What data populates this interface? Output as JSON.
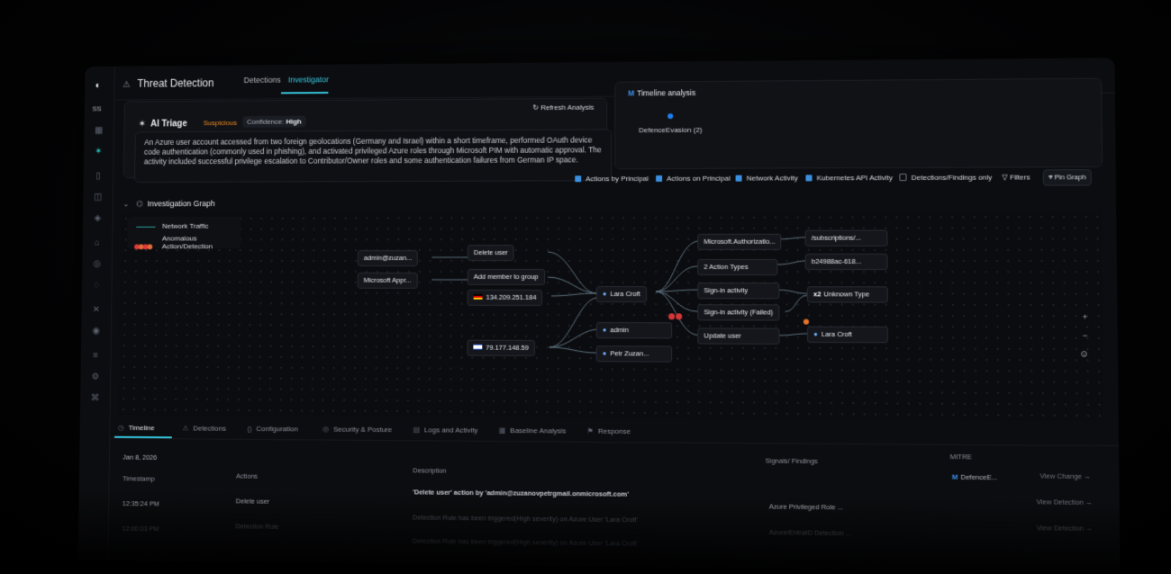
{
  "sidebar": {
    "initials": "SS"
  },
  "topbar": {
    "title": "Threat Detection",
    "tabs": [
      {
        "label": "Detections"
      },
      {
        "label": "Investigator"
      }
    ]
  },
  "ai_triage": {
    "title": "AI Triage",
    "verdict": "Suspicious",
    "confidence_label": "Confidence:",
    "confidence_value": "High",
    "refresh_label": "Refresh Analysis",
    "description": "An Azure user account accessed from two foreign geolocations (Germany and Israel) within a short timeframe, performed OAuth device code authentication (commonly used in phishing), and activated privileged Azure roles through Microsoft PIM with automatic approval. The activity included successful privilege escalation to Contributor/Owner roles and some authentication failures from German IP space."
  },
  "timeline_analysis": {
    "title": "Timeline analysis",
    "item": "DefenceEvasion (2)"
  },
  "filters": {
    "checkboxes": [
      {
        "label": "Actions by Principal",
        "checked": true
      },
      {
        "label": "Actions on Principal",
        "checked": true
      },
      {
        "label": "Network Activity",
        "checked": true
      },
      {
        "label": "Kubernetes API Activity",
        "checked": true
      },
      {
        "label": "Detections/Findings only",
        "checked": false
      }
    ],
    "filters_label": "Filters",
    "pin_label": "Pin Graph"
  },
  "graph": {
    "title": "Investigation Graph",
    "legend": {
      "network": "Network Traffic",
      "anomalous": "Anomalous Action/Detection"
    },
    "nodes": {
      "admin_principal": "admin@zuzan...",
      "ms_app": "Microsoft Appr...",
      "delete_user": "Delete user",
      "add_member": "Add member to group",
      "ip_de": "134.209.251.184",
      "ip_il": "79.177.148.59",
      "lara": "Lara Croft",
      "admin": "admin",
      "petr": "Petr Zuzan...",
      "ms_auth": "Microsoft.Authorizatio...",
      "action_types": "2 Action Types",
      "signin": "Sign-in activity",
      "signin_failed": "Sign-in activity (Failed)",
      "update_user": "Update user",
      "subscriptions": "/subscriptions/...",
      "hash": "b24988ac-618...",
      "unknown": "Unknown Type",
      "unknown_mult": "x2",
      "lara_target": "Lara Croft"
    },
    "zoom": {
      "in": "+",
      "out": "−",
      "fit": "⊙"
    }
  },
  "bottom_tabs": [
    {
      "label": "Timeline"
    },
    {
      "label": "Detections"
    },
    {
      "label": "Configuration"
    },
    {
      "label": "Security & Posture"
    },
    {
      "label": "Logs and Activity"
    },
    {
      "label": "Baseline Analysis"
    },
    {
      "label": "Response"
    }
  ],
  "table": {
    "date": "Jan 8, 2026",
    "headers": {
      "timestamp": "Timestamp",
      "actions": "Actions",
      "description": "Description",
      "signals": "Signals/ Findings",
      "mitre": "MITRE"
    },
    "mitre_top": "DefenceE...",
    "view_change": "View Change →",
    "rows": [
      {
        "time": "12:35:24 PM",
        "action": "Delete user",
        "description": "'Delete user' action by 'admin@zuzanovpetrgmail.onmicrosoft.com'",
        "signal": "Azure Privileged Role ...",
        "link": "View Detection →"
      },
      {
        "time": "12:00:03 PM",
        "action": "Detection Rule",
        "description": "Detection Rule has been triggered(High severity) on Azure User 'Lara Croft'",
        "signal": "Azure/EntraID Detection ...",
        "link": "View Detection →"
      },
      {
        "time": "",
        "action": "",
        "description": "Detection Rule has been triggered(High severity) on Azure User 'Lara Croft'",
        "signal": "",
        "link": ""
      }
    ]
  },
  "colors": {
    "accent": "#35c8e0",
    "warning": "#f08a24",
    "danger": "#d43737",
    "checkbox": "#3a8fde"
  }
}
